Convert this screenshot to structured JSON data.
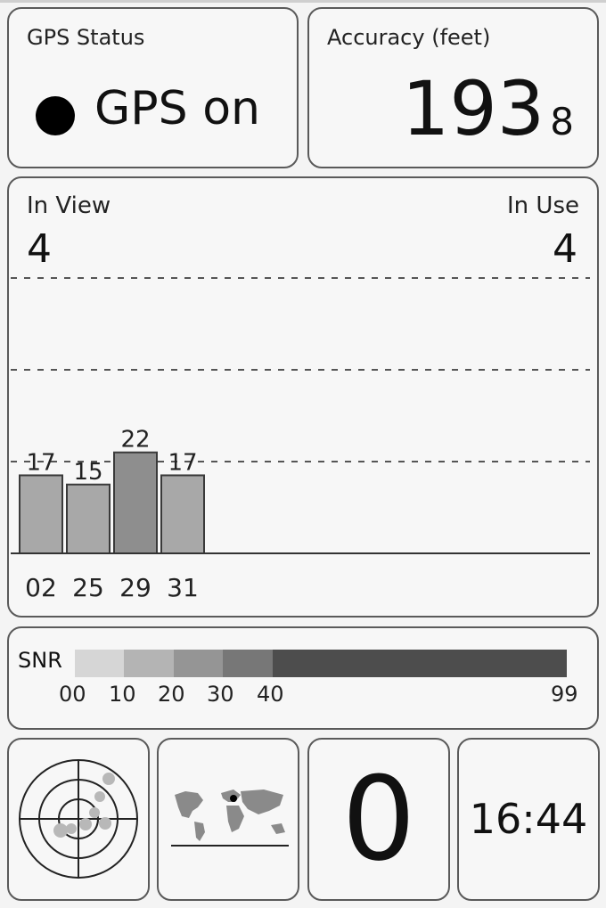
{
  "status": {
    "title": "GPS Status",
    "value": "GPS on",
    "icon": "status-dot-icon"
  },
  "accuracy": {
    "title": "Accuracy (feet)",
    "value": "193",
    "decimal": "8"
  },
  "satellites": {
    "in_view_label": "In View",
    "in_view": "4",
    "in_use_label": "In Use",
    "in_use": "4"
  },
  "chart_data": {
    "type": "bar",
    "categories": [
      "02",
      "25",
      "29",
      "31"
    ],
    "values": [
      17,
      15,
      22,
      17
    ],
    "ylim": [
      0,
      60
    ],
    "gridlines": [
      20,
      40,
      60
    ],
    "grid": true,
    "colors": [
      "#a8a8a8",
      "#a8a8a8",
      "#8e8e8e",
      "#a8a8a8"
    ]
  },
  "snr": {
    "label": "SNR",
    "ticks": [
      "00",
      "10",
      "20",
      "30",
      "40",
      "99"
    ],
    "colors": [
      "#d6d6d6",
      "#b4b4b4",
      "#959595",
      "#777777",
      "#4d4d4d"
    ]
  },
  "bottom": {
    "radar_icon": "sky-radar-icon",
    "map_icon": "world-map-icon",
    "fix_count": "0",
    "time": "16:44"
  }
}
